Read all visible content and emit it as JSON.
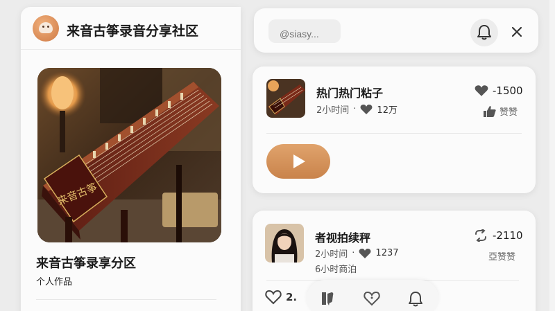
{
  "app": {
    "title": "来音古筝录音分享社区"
  },
  "featured": {
    "album_title": "来音古筝录享分区",
    "album_subtitle": "个人作品",
    "instrument_inscription": "来音古筝"
  },
  "topbar": {
    "search_placeholder": "@siasy..."
  },
  "posts": [
    {
      "title": "热门热门粘子",
      "time": "2小时间",
      "dot": "·",
      "likes_meta": "12万",
      "stat_value": "-1500",
      "secondary_label": "赞赞"
    },
    {
      "title": "者视拍续秤",
      "time": "2小时间",
      "dot": "·",
      "likes_meta": "1237",
      "extra_line": "6小时商泊",
      "stat_value": "-2110",
      "secondary_label": "亞赞赞"
    }
  ],
  "bottom": {
    "like_count": "2."
  },
  "icons": [
    "user-avatar-icon",
    "bell-icon",
    "close-icon",
    "heart-icon",
    "thumbs-up-icon",
    "play-icon",
    "repost-icon",
    "dislike-icon",
    "heart-outline-icon"
  ],
  "colors": {
    "accent": "#d38f56",
    "background": "#ececec",
    "card": "#fbfbfb"
  }
}
